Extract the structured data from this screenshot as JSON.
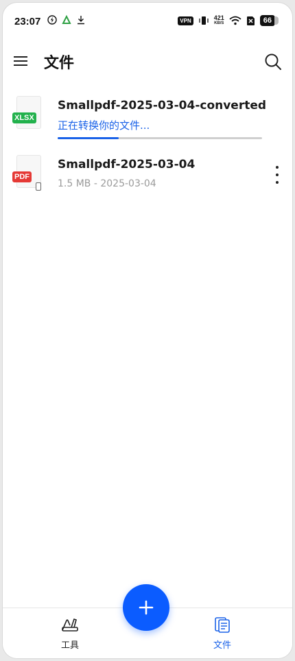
{
  "status_bar": {
    "time": "23:07",
    "vpn_label": "VPN",
    "net_speed": "421",
    "net_speed_unit": "KB/S",
    "battery": "66"
  },
  "app_bar": {
    "title": "文件",
    "menu_icon": "hamburger-menu-icon",
    "search_icon": "search-icon"
  },
  "files": [
    {
      "name": "Smallpdf-2025-03-04-converted",
      "type_badge": "XLSX",
      "status_text": "正在转换你的文件...",
      "progress": 0.3
    },
    {
      "name": "Smallpdf-2025-03-04",
      "type_badge": "PDF",
      "meta": "1.5 MB - 2025-03-04",
      "more_icon": "more-vertical-icon"
    }
  ],
  "bottom_nav": {
    "tools_label": "工具",
    "files_label": "文件",
    "active": "files"
  },
  "colors": {
    "accent": "#1a62e8",
    "fab": "#0b5cff",
    "xlsx": "#22b14c",
    "pdf": "#e53935"
  }
}
